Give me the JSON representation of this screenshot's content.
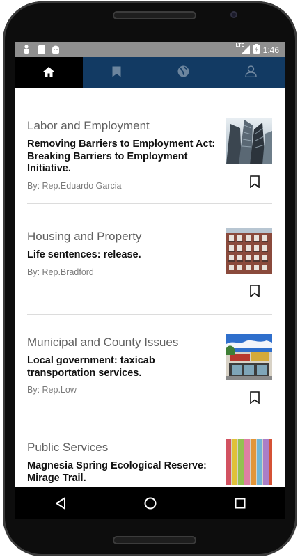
{
  "status_bar": {
    "time": "1:46",
    "network": "LTE",
    "left_icons": [
      "person-icon",
      "sd-card-icon",
      "android-icon"
    ],
    "right_icons": [
      "signal-icon",
      "battery-icon"
    ]
  },
  "tabs": [
    {
      "icon": "home-icon",
      "active": true
    },
    {
      "icon": "bookmark-icon",
      "active": false
    },
    {
      "icon": "globe-icon",
      "active": false
    },
    {
      "icon": "user-icon",
      "active": false
    }
  ],
  "articles": [
    {
      "category": "Labor and Employment",
      "title": "Removing Barriers to Employment Act: Breaking Barriers to Employment Initiative.",
      "author": "By: Rep.Eduardo Garcia",
      "image": "skyscrapers-image"
    },
    {
      "category": "Housing and Property",
      "title": "Life sentences: release.",
      "author": "By: Rep.Bradford",
      "image": "brick-building-image"
    },
    {
      "category": "Municipal and County Issues",
      "title": "Local government: taxicab transportation services.",
      "author": "By: Rep.Low",
      "image": "storefront-image"
    },
    {
      "category": "Public Services",
      "title": "Magnesia Spring Ecological Reserve: Mirage Trail.",
      "author": "",
      "image": "colored-chalk-image"
    }
  ],
  "nav": [
    "back-icon",
    "home-circle-icon",
    "recents-icon"
  ],
  "colors": {
    "tab_bar": "#123a63",
    "status_bar": "#8f8f8f",
    "active_tab": "#000000"
  }
}
